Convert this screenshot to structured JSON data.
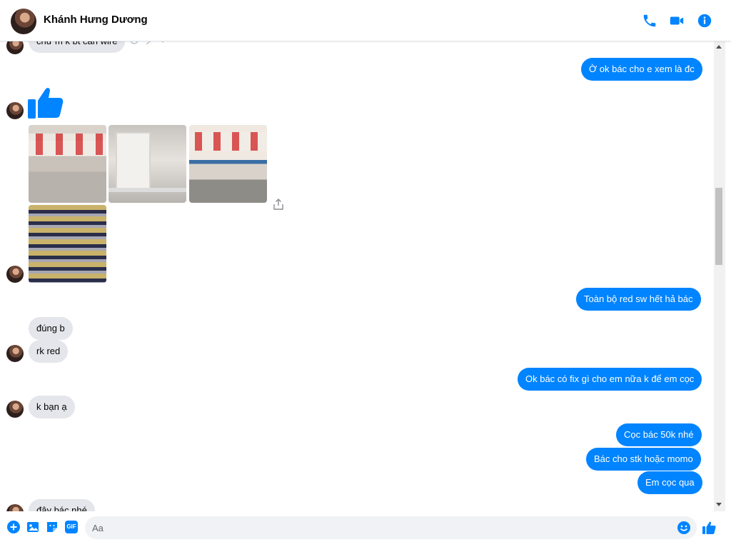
{
  "header": {
    "contact_name": "Khánh Hưng Dương",
    "icons": [
      "phone-icon",
      "video-camera-icon",
      "info-icon"
    ],
    "accent": "#0084ff"
  },
  "messages": [
    {
      "side": "in",
      "text": "chứ m k bt cân wire"
    },
    {
      "side": "out",
      "text": "Ờ ok bác cho e xem là đc"
    },
    {
      "side": "in",
      "type": "like-sticker"
    },
    {
      "side": "in",
      "type": "photos",
      "count": 4
    },
    {
      "side": "out",
      "text": "Toàn bộ red sw hết hả bác"
    },
    {
      "side": "in",
      "text": "đúng b"
    },
    {
      "side": "in",
      "text": "rk red"
    },
    {
      "side": "out",
      "text": "Ok bác có fix gì cho em nữa k để em cọc"
    },
    {
      "side": "in",
      "text": "k bạn ạ"
    },
    {
      "side": "out",
      "text": "Cọc bác 50k nhé"
    },
    {
      "side": "out",
      "text": "Bác cho stk hoặc momo"
    },
    {
      "side": "out",
      "text": "Em cọc qua"
    },
    {
      "side": "in",
      "text": "đây bác nhé"
    }
  ],
  "composer": {
    "placeholder": "Aa",
    "icons": [
      "plus-icon",
      "image-icon",
      "sticker-icon",
      "gif-icon",
      "emoji-icon",
      "thumbs-up-icon"
    ],
    "gif_label": "GIF"
  },
  "colors": {
    "incoming_bubble": "#e4e6eb",
    "outgoing_bubble": "#0084ff"
  }
}
